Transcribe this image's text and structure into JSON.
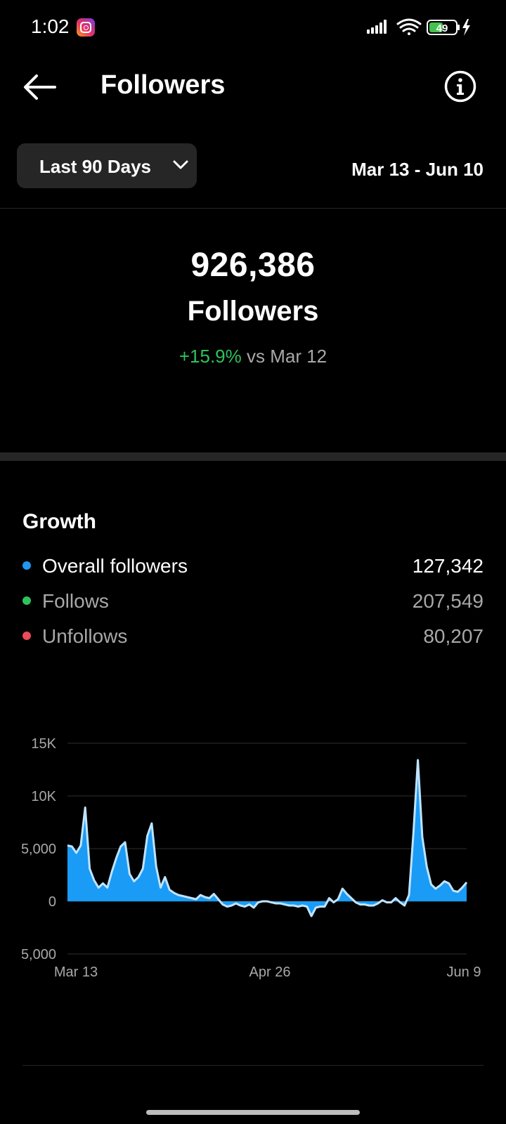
{
  "status_bar": {
    "time": "1:02",
    "battery": "49"
  },
  "header": {
    "title": "Followers"
  },
  "filter": {
    "label": "Last 90 Days",
    "date_range": "Mar 13 - Jun 10"
  },
  "summary": {
    "total": "926,386",
    "label": "Followers",
    "change": "+15.9%",
    "change_suffix": "vs Mar 12"
  },
  "growth": {
    "title": "Growth",
    "legend": [
      {
        "label": "Overall followers",
        "value": "127,342",
        "color": "#2196f3"
      },
      {
        "label": "Follows",
        "value": "207,549",
        "color": "#2fc25b"
      },
      {
        "label": "Unfollows",
        "value": "80,207",
        "color": "#ed4956"
      }
    ]
  },
  "chart_data": {
    "type": "area",
    "x_labels": [
      "Mar 13",
      "Apr 26",
      "Jun 9"
    ],
    "y_ticks": [
      "15K",
      "10K",
      "5,000",
      "0",
      "5,000"
    ],
    "ylim": [
      -5000,
      15000
    ],
    "grid": true,
    "fill_color": "#1a9bf5",
    "line_color": "#bfe3ff",
    "series": [
      {
        "values": [
          5300,
          5200,
          4600,
          5300,
          8900,
          3100,
          2000,
          1300,
          1700,
          1300,
          2800,
          4100,
          5200,
          5600,
          2600,
          1900,
          2300,
          3100,
          6200,
          7400,
          3300,
          1300,
          2300,
          1100,
          800,
          600,
          500,
          400,
          300,
          200,
          600,
          400,
          300,
          700,
          200,
          -300,
          -500,
          -400,
          -200,
          -400,
          -500,
          -300,
          -600,
          -100,
          0,
          0,
          -100,
          -200,
          -200,
          -300,
          -400,
          -400,
          -500,
          -400,
          -500,
          -1400,
          -600,
          -500,
          -500,
          300,
          -100,
          200,
          1200,
          700,
          300,
          -100,
          -300,
          -300,
          -400,
          -400,
          -200,
          100,
          -100,
          -100,
          300,
          -100,
          -400,
          600,
          6500,
          13400,
          6100,
          3300,
          1600,
          1200,
          1500,
          1900,
          1700,
          1000,
          900,
          1300,
          1800
        ]
      }
    ]
  }
}
